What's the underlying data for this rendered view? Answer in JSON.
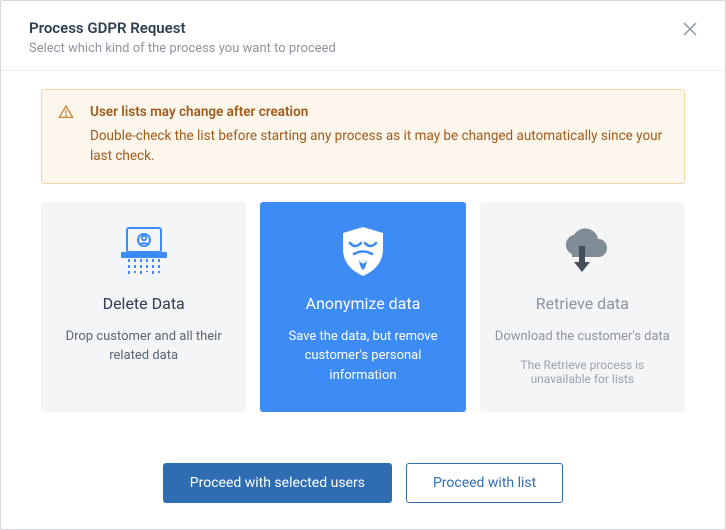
{
  "header": {
    "title": "Process GDPR Request",
    "subtitle": "Select which kind of the process you want to proceed"
  },
  "alert": {
    "title": "User lists may change after creation",
    "text": "Double-check the list before starting any process as it may be changed automatically since your last check."
  },
  "options": {
    "delete": {
      "title": "Delete Data",
      "desc": "Drop customer and all their related data"
    },
    "anonymize": {
      "title": "Anonymize data",
      "desc": "Save the data, but remove customer's personal information"
    },
    "retrieve": {
      "title": "Retrieve data",
      "desc": "Download the customer's data",
      "note": "The Retrieve process is unavailable for lists"
    }
  },
  "footer": {
    "primary": "Proceed with selected users",
    "secondary": "Proceed with list"
  }
}
